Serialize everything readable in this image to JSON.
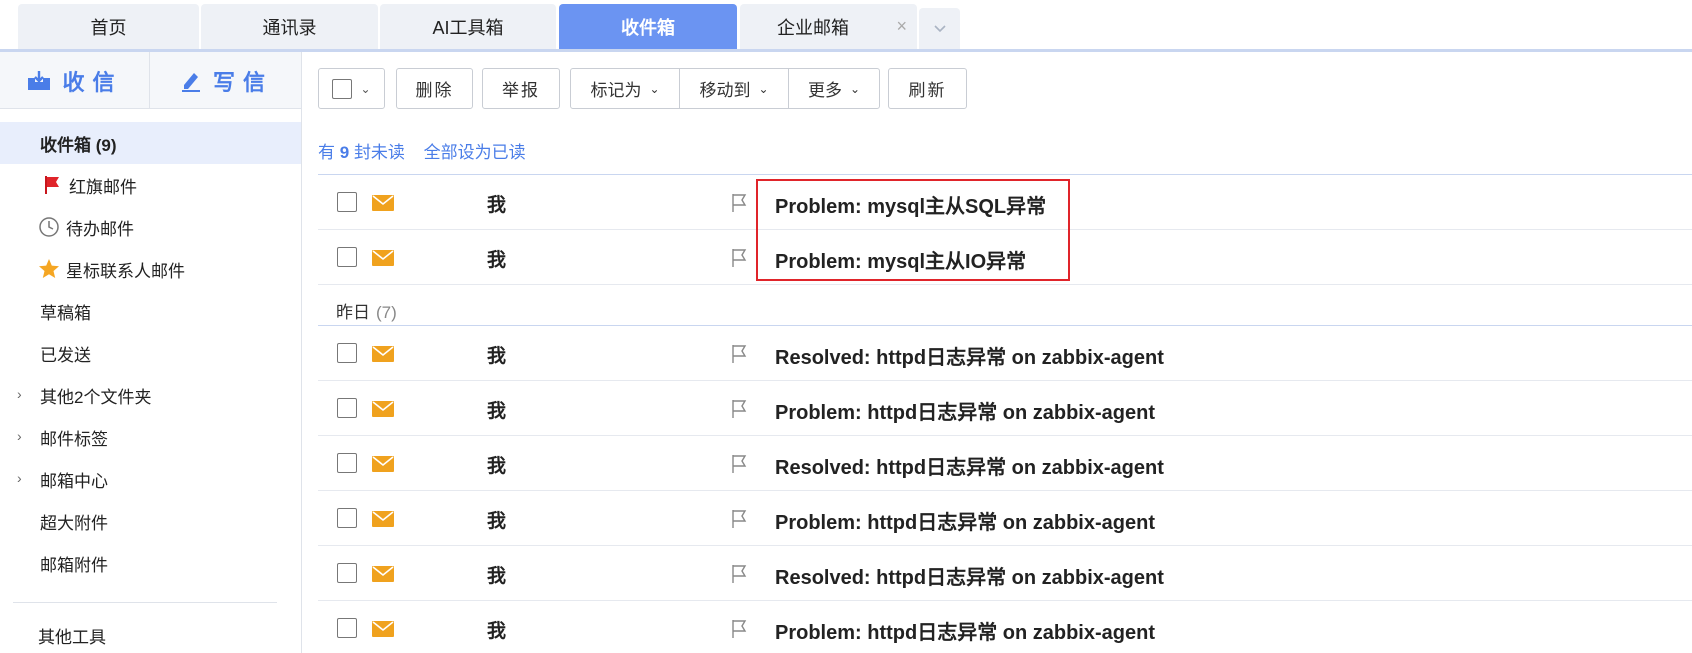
{
  "tabs": [
    {
      "label": "首页"
    },
    {
      "label": "通讯录"
    },
    {
      "label": "AI工具箱"
    },
    {
      "label": "收件箱",
      "active": true
    },
    {
      "label": "企业邮箱",
      "close": "×"
    }
  ],
  "sidebar": {
    "receive_label": "收信",
    "write_label": "写信",
    "folders": [
      {
        "label": "收件箱 (9)"
      },
      {
        "label": "红旗邮件",
        "icon": "red-flag-icon"
      },
      {
        "label": "待办邮件",
        "icon": "clock-icon"
      },
      {
        "label": "星标联系人邮件",
        "icon": "star-icon"
      },
      {
        "label": "草稿箱"
      },
      {
        "label": "已发送"
      },
      {
        "label": "其他2个文件夹",
        "expandable": true
      },
      {
        "label": "邮件标签",
        "expandable": true
      },
      {
        "label": "邮箱中心",
        "expandable": true
      },
      {
        "label": "超大附件"
      },
      {
        "label": "邮箱附件"
      }
    ],
    "other_tools": "其他工具"
  },
  "toolbar": {
    "delete": "删除",
    "report": "举报",
    "mark_as": "标记为",
    "move_to": "移动到",
    "more": "更多",
    "refresh": "刷新"
  },
  "unread": {
    "prefix": "有",
    "count": "9",
    "suffix": "封未读",
    "mark_all": "全部设为已读"
  },
  "colors": {
    "accent": "#6b94f2",
    "link": "#4a7de8",
    "envelope": "#f0a21e",
    "highlight": "#e0242a"
  },
  "mails_today": [
    {
      "sender": "我",
      "subject": "Problem: mysql主从SQL异常"
    },
    {
      "sender": "我",
      "subject": "Problem: mysql主从IO异常"
    }
  ],
  "yesterday": {
    "label": "昨日",
    "count": "(7)"
  },
  "mails_yesterday": [
    {
      "sender": "我",
      "subject": "Resolved: httpd日志异常 on zabbix-agent"
    },
    {
      "sender": "我",
      "subject": "Problem: httpd日志异常 on zabbix-agent"
    },
    {
      "sender": "我",
      "subject": "Resolved: httpd日志异常 on zabbix-agent"
    },
    {
      "sender": "我",
      "subject": "Problem: httpd日志异常 on zabbix-agent"
    },
    {
      "sender": "我",
      "subject": "Resolved: httpd日志异常 on zabbix-agent"
    },
    {
      "sender": "我",
      "subject": "Problem: httpd日志异常 on zabbix-agent"
    }
  ]
}
